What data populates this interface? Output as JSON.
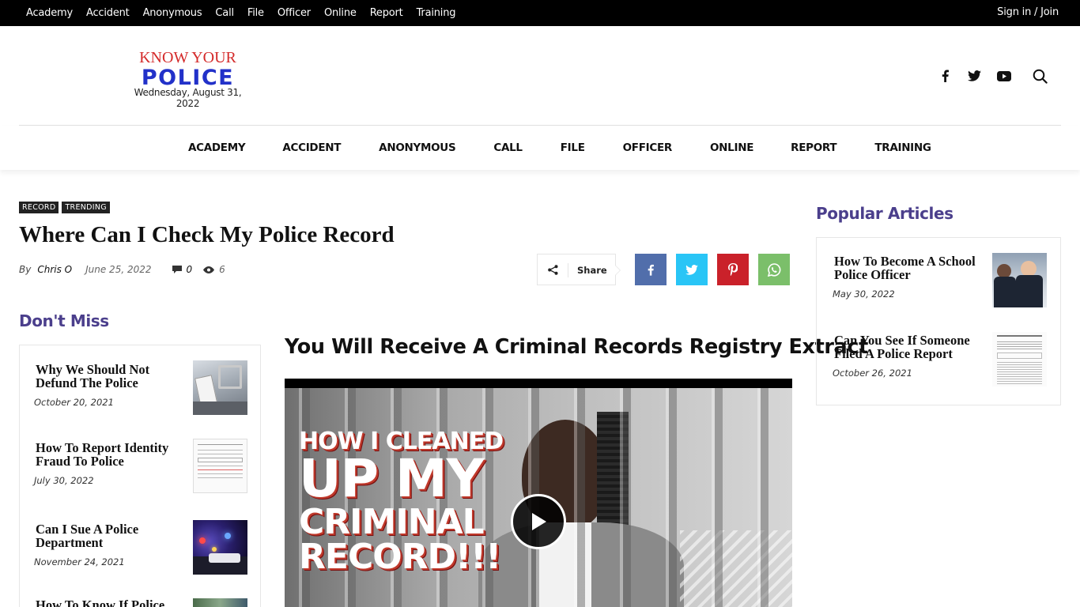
{
  "topbar": {
    "links": [
      "Academy",
      "Accident",
      "Anonymous",
      "Call",
      "File",
      "Officer",
      "Online",
      "Report",
      "Training"
    ],
    "signin": "Sign in / Join"
  },
  "logo": {
    "line1": "KNOW YOUR",
    "line2": "POLICE",
    "date": "Wednesday, August 31, 2022"
  },
  "social": {
    "icons": [
      "facebook-icon",
      "twitter-icon",
      "youtube-icon",
      "search-icon"
    ]
  },
  "nav": {
    "items": [
      "ACADEMY",
      "ACCIDENT",
      "ANONYMOUS",
      "CALL",
      "FILE",
      "OFFICER",
      "ONLINE",
      "REPORT",
      "TRAINING"
    ]
  },
  "article": {
    "tags": [
      "RECORD",
      "TRENDING"
    ],
    "title": "Where Can I Check My Police Record",
    "by": "By",
    "author": "Chris O",
    "date": "June 25, 2022",
    "comments": "0",
    "views": "6",
    "share_label": "Share",
    "subheading": "You Will Receive A Criminal Records Registry Extract",
    "video_text": [
      "HOW I CLEANED",
      "UP MY",
      "CRIMINAL",
      "RECORD!!!"
    ]
  },
  "share_colors": {
    "facebook": "#516eab",
    "twitter": "#29c5f6",
    "pinterest": "#ca212a",
    "whatsapp": "#7bbf6a"
  },
  "dont_miss": {
    "heading": "Don't Miss",
    "items": [
      {
        "title": "Why We Should Not Defund The Police",
        "date": "October 20, 2021"
      },
      {
        "title": "How To Report Identity Fraud To Police",
        "date": "July 30, 2022"
      },
      {
        "title": "Can I Sue A Police Department",
        "date": "November 24, 2021"
      },
      {
        "title": "How To Know If Police",
        "date": ""
      }
    ]
  },
  "popular": {
    "heading": "Popular Articles",
    "items": [
      {
        "title": "How To Become A School Police Officer",
        "date": "May 30, 2022"
      },
      {
        "title": "Can You See If Someone Filed A Police Report",
        "date": "October 26, 2021"
      }
    ]
  },
  "colors": {
    "accent": "#4b3f8c",
    "logo_red": "#d42a2a",
    "logo_blue": "#2231c9"
  }
}
